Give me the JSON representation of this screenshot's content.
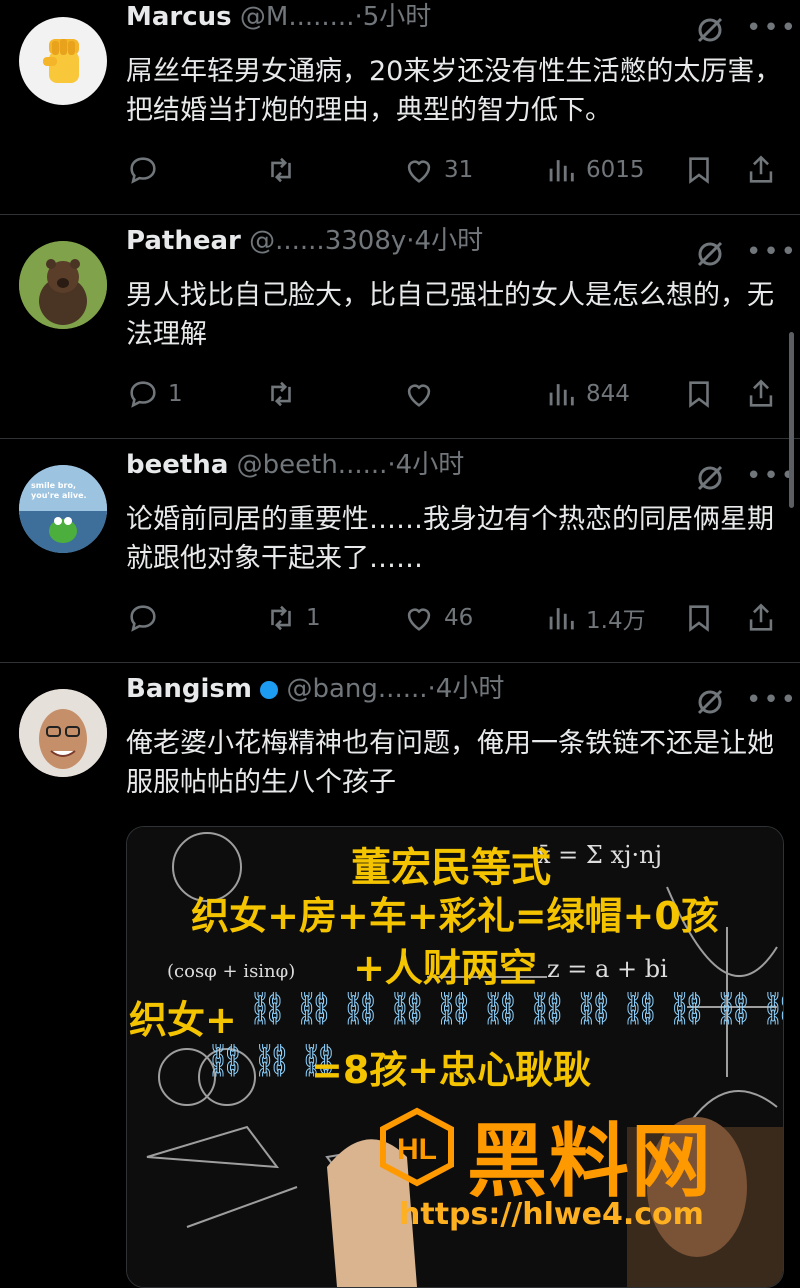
{
  "tweets": [
    {
      "name": "Marcus",
      "handle": "@M........",
      "time": "5小时",
      "text": "屌丝年轻男女通病，20来岁还没有性生活憋的太厉害，把结婚当打炮的理由，典型的智力低下。",
      "replies": "",
      "retweets": "",
      "likes": "31",
      "views": "6015"
    },
    {
      "name": "Pathear",
      "handle": "@......3308y",
      "time": "4小时",
      "text": "男人找比自己脸大，比自己强壮的女人是怎么想的，无法理解",
      "replies": "1",
      "retweets": "",
      "likes": "",
      "views": "844"
    },
    {
      "name": "beetha",
      "handle": "@beeth......",
      "time": "4小时",
      "avatar_text": "smile bro, you're alive.",
      "text": "论婚前同居的重要性……我身边有个热恋的同居俩星期就跟他对象干起来了……",
      "replies": "",
      "retweets": "1",
      "likes": "46",
      "views": "1.4万"
    },
    {
      "name": "Bangism",
      "handle": "@bang......",
      "time": "4小时",
      "text": "俺老婆小花梅精神也有问题，俺用一条铁链不还是让她服服帖帖的生八个孩子",
      "replies": "",
      "retweets": "",
      "likes": "",
      "views": ""
    }
  ],
  "media": {
    "lines": [
      "董宏民等式",
      "织女+房+车+彩礼=绿帽+0孩",
      "+人财两空",
      "织女+",
      "=8孩+忠心耿耿"
    ],
    "formula_1": "x̄ = Σ xj·nj",
    "formula_2": "z = a + bi",
    "formula_3": "(cosφ + isinφ)",
    "watermark_logo": "黑料网",
    "watermark_url": "https://hlwe4.com"
  },
  "colors": {
    "background": "#000000",
    "text": "#e7e9ea",
    "secondary": "#71767b",
    "divider": "#2f3336",
    "meme_yellow": "#f5c400",
    "watermark_orange": "#ff9900"
  },
  "icons": [
    "reply-icon",
    "retweet-icon",
    "like-icon",
    "views-icon",
    "bookmark-icon",
    "share-icon",
    "grok-icon",
    "more-icon"
  ]
}
